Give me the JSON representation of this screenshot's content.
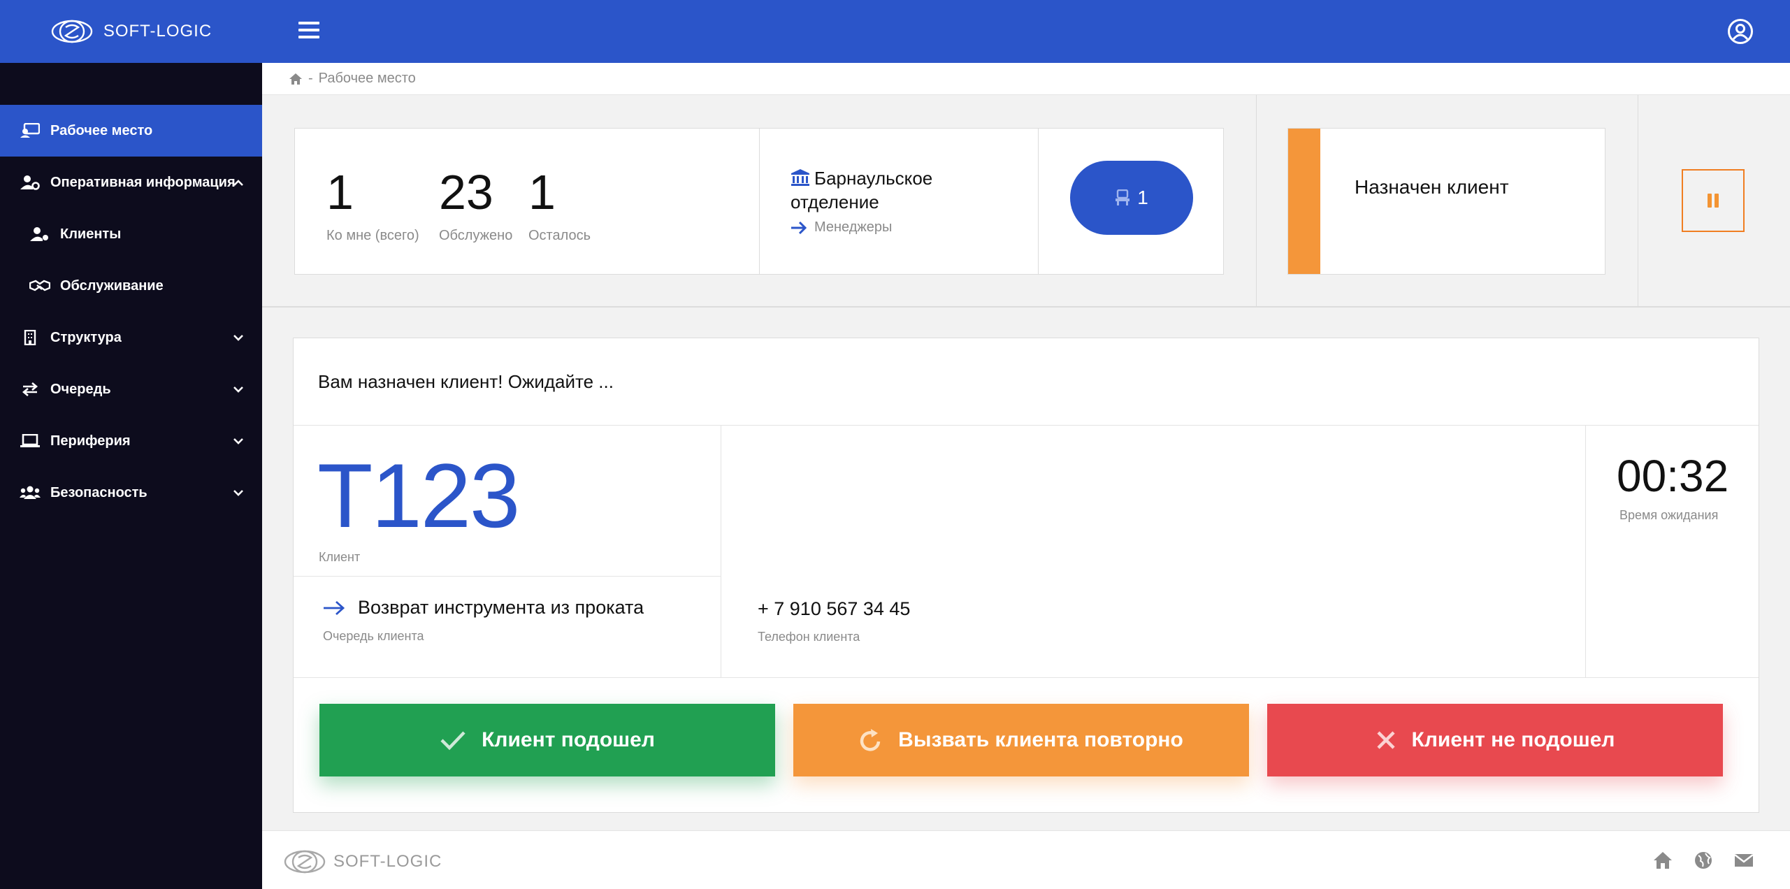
{
  "brand": {
    "name": "SOFT-LOGIC"
  },
  "breadcrumb": {
    "current": "Рабочее место",
    "separator": "-"
  },
  "sidebar": {
    "items": [
      {
        "label": "Рабочее место",
        "icon": "workplace-icon",
        "active": true
      },
      {
        "label": "Оперативная информация",
        "icon": "user-gear-icon",
        "expanded": true
      },
      {
        "label": "Клиенты",
        "icon": "clients-icon",
        "sub": true
      },
      {
        "label": "Обслуживание",
        "icon": "handshake-icon",
        "sub": true
      },
      {
        "label": "Структура",
        "icon": "building-icon"
      },
      {
        "label": "Очередь",
        "icon": "exchange-icon"
      },
      {
        "label": "Периферия",
        "icon": "laptop-icon"
      },
      {
        "label": "Безопасность",
        "icon": "users-icon"
      }
    ]
  },
  "stats": [
    {
      "value": "1",
      "label": "Ко мне (всего)"
    },
    {
      "value": "23",
      "label": "Обслужено"
    },
    {
      "value": "1",
      "label": "Осталось"
    }
  ],
  "branch": {
    "name": "Барнаульское отделение",
    "role": "Менеджеры"
  },
  "window_count": "1",
  "status": {
    "text": "Назначен клиент",
    "color": "#f4963a"
  },
  "panel": {
    "message": "Вам назначен клиент! Ожидайте ...",
    "ticket": "Т123",
    "ticket_label": "Клиент",
    "queue": "Возврат инструмента из проката",
    "queue_label": "Очередь клиента",
    "phone": "+ 7 910 567 34 45",
    "phone_label": "Телефон клиента",
    "timer": "00:32",
    "timer_label": "Время ожидания"
  },
  "actions": {
    "arrived": "Клиент подошел",
    "recall": "Вызвать клиента повторно",
    "not_arrived": "Клиент не подошел"
  },
  "colors": {
    "primary": "#2b55c9",
    "sidebar": "#0d0c1d",
    "success": "#21a052",
    "warning": "#f4963a",
    "danger": "#e8494f"
  }
}
